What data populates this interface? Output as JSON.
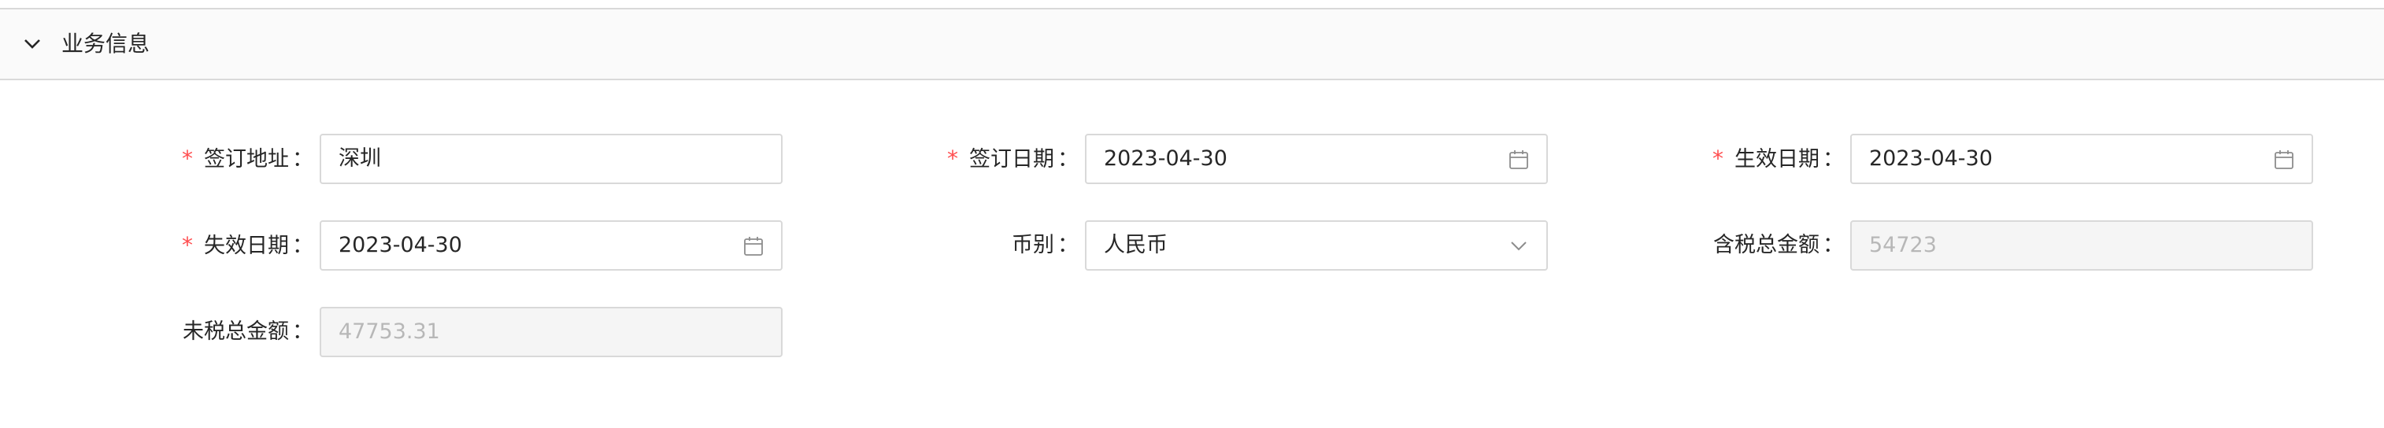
{
  "section": {
    "title": "业务信息",
    "collapse_icon": "chevron-down-icon"
  },
  "form": {
    "sign_address": {
      "label": "签订地址",
      "value": "深圳",
      "required": true
    },
    "sign_date": {
      "label": "签订日期",
      "value": "2023-04-30",
      "required": true,
      "icon": "calendar-icon"
    },
    "effective_date": {
      "label": "生效日期",
      "value": "2023-04-30",
      "required": true,
      "icon": "calendar-icon"
    },
    "expiry_date": {
      "label": "失效日期",
      "value": "2023-04-30",
      "required": true,
      "icon": "calendar-icon"
    },
    "currency": {
      "label": "币别",
      "value": "人民币",
      "required": false,
      "icon": "chevron-down-icon"
    },
    "total_with_tax": {
      "label": "含税总金额",
      "value": "54723",
      "required": false,
      "disabled": true
    },
    "total_without_tax": {
      "label": "未税总金额",
      "value": "47753.31",
      "required": false,
      "disabled": true
    }
  },
  "colors": {
    "required_marker": "#ff4d4f",
    "border": "#d9d9d9",
    "header_bg": "#fafafa",
    "disabled_bg": "#f5f5f5"
  }
}
